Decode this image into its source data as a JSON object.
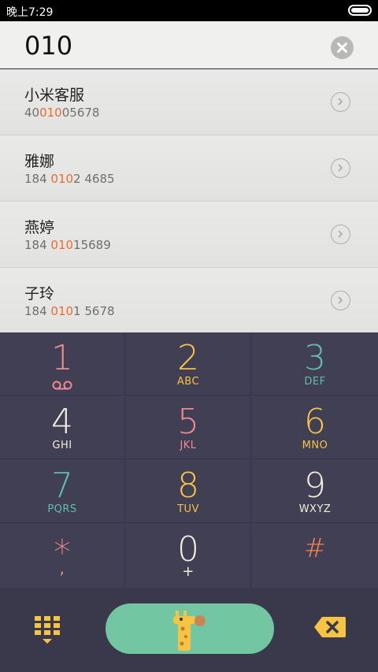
{
  "status_bar": {
    "time": "晚上7:29",
    "battery_icon": "battery-icon"
  },
  "search": {
    "value": "010",
    "clear_icon": "clear-icon"
  },
  "contacts": [
    {
      "name": "小米客服",
      "number_pre": "40",
      "number_match": "010",
      "number_post": "05678"
    },
    {
      "name": "雅娜",
      "number_pre": "184 ",
      "number_match": "010",
      "number_post": "2 4685"
    },
    {
      "name": "燕婷",
      "number_pre": "184 ",
      "number_match": "010",
      "number_post": "15689"
    },
    {
      "name": "子玲",
      "number_pre": "184 ",
      "number_match": "010",
      "number_post": "1 5678"
    }
  ],
  "keypad": {
    "keys": [
      {
        "digit": "1",
        "letters": "",
        "color": "#f08a8f"
      },
      {
        "digit": "2",
        "letters": "ABC",
        "color": "#f6c343"
      },
      {
        "digit": "3",
        "letters": "DEF",
        "color": "#5ebfa8"
      },
      {
        "digit": "4",
        "letters": "GHI",
        "color": "#f3ede0"
      },
      {
        "digit": "5",
        "letters": "JKL",
        "color": "#f08a8f"
      },
      {
        "digit": "6",
        "letters": "MNO",
        "color": "#f6c343"
      },
      {
        "digit": "7",
        "letters": "PQRS",
        "color": "#5ebfa8"
      },
      {
        "digit": "8",
        "letters": "TUV",
        "color": "#f6c343"
      },
      {
        "digit": "9",
        "letters": "WXYZ",
        "color": "#f3ede0"
      },
      {
        "digit": "*",
        "letters": ",",
        "color": "#f08a8f"
      },
      {
        "digit": "0",
        "letters": "+",
        "color": "#f3ede0"
      },
      {
        "digit": "#",
        "letters": "",
        "color": "#f28250"
      }
    ]
  },
  "bottom_bar": {
    "dialpad_icon": "dialpad-grid-icon",
    "call_icon": "giraffe-call-icon",
    "backspace_icon": "backspace-icon",
    "call_color": "#72c7a2",
    "accent_yellow": "#f6c343"
  }
}
